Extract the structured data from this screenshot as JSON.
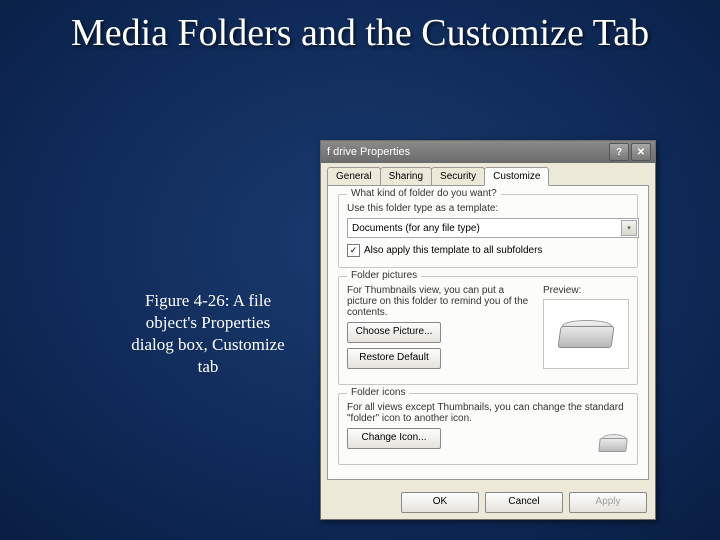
{
  "slide": {
    "title": "Media Folders and the Customize Tab",
    "caption": "Figure 4-26: A file object's Properties dialog box, Customize tab"
  },
  "dialog": {
    "title": "f drive Properties",
    "tabs": [
      "General",
      "Sharing",
      "Security",
      "Customize"
    ],
    "active_tab": 3,
    "group1": {
      "legend": "What kind of folder do you want?",
      "instr": "Use this folder type as a template:",
      "select_value": "Documents (for any file type)",
      "check_label": "Also apply this template to all subfolders",
      "checked": true
    },
    "group2": {
      "legend": "Folder pictures",
      "instr": "For Thumbnails view, you can put a picture on this folder to remind you of the contents.",
      "choose_btn": "Choose Picture...",
      "restore_btn": "Restore Default",
      "preview_label": "Preview:"
    },
    "group3": {
      "legend": "Folder icons",
      "instr": "For all views except Thumbnails, you can change the standard \"folder\" icon to another icon.",
      "change_btn": "Change Icon..."
    },
    "buttons": {
      "ok": "OK",
      "cancel": "Cancel",
      "apply": "Apply"
    }
  }
}
